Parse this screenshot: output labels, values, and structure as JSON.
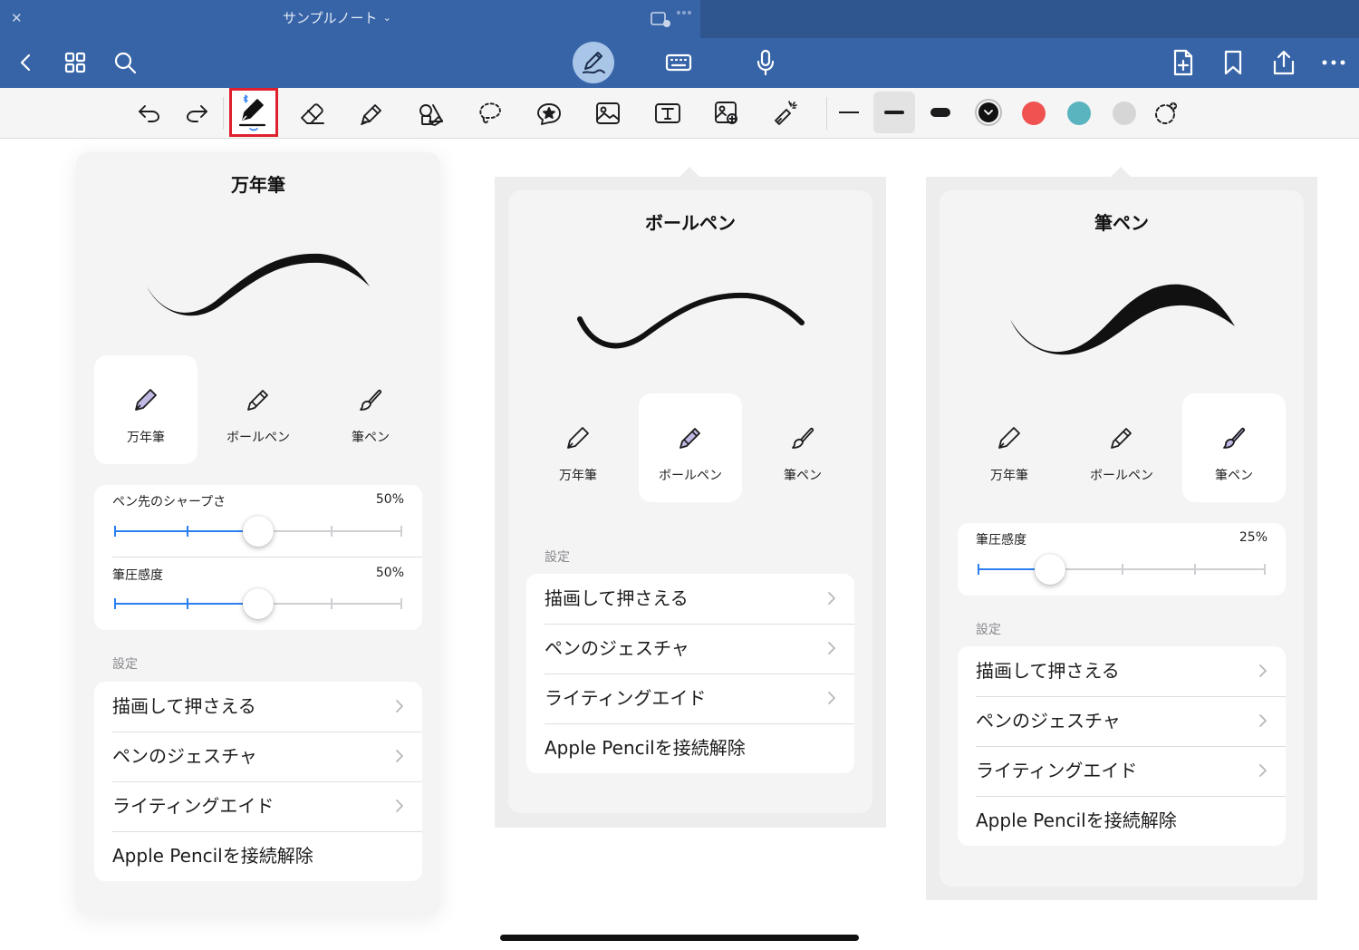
{
  "window": {
    "title": "サンプルノート",
    "close_icon": "close-icon"
  },
  "navbar": {
    "left_icons": [
      "back-icon",
      "grid-icon",
      "search-icon"
    ],
    "center_icons": [
      "pen-mode-icon",
      "keyboard-icon",
      "microphone-icon"
    ],
    "right_icons": [
      "add-page-icon",
      "bookmark-icon",
      "share-icon",
      "more-icon"
    ]
  },
  "toolbar": {
    "tools": [
      "undo-icon",
      "redo-icon",
      "fountain-pen-icon",
      "eraser-icon",
      "highlighter-icon",
      "shapes-icon",
      "lasso-icon",
      "sticker-icon",
      "image-icon",
      "textbox-icon",
      "camera-icon",
      "laser-pointer-icon"
    ],
    "selected_tool": "fountain-pen-icon",
    "stroke_widths": [
      "thin",
      "medium",
      "thick"
    ],
    "selected_width": "medium",
    "colors": [
      "#111111",
      "#f05252",
      "#5ab4c0",
      "#d6d6d6"
    ],
    "selected_color": "#111111"
  },
  "panels": [
    {
      "title": "万年筆",
      "pens": [
        {
          "label": "万年筆"
        },
        {
          "label": "ボールペン"
        },
        {
          "label": "筆ペン"
        }
      ],
      "selected_pen": 0,
      "sliders": [
        {
          "label": "ペン先のシャープさ",
          "value_text": "50%",
          "value": 0.5
        },
        {
          "label": "筆圧感度",
          "value_text": "50%",
          "value": 0.5
        }
      ],
      "settings_label": "設定",
      "settings": [
        "描画して押さえる",
        "ペンのジェスチャ",
        "ライティングエイド",
        "Apple Pencilを接続解除"
      ]
    },
    {
      "title": "ボールペン",
      "pens": [
        {
          "label": "万年筆"
        },
        {
          "label": "ボールペン"
        },
        {
          "label": "筆ペン"
        }
      ],
      "selected_pen": 1,
      "sliders": [],
      "settings_label": "設定",
      "settings": [
        "描画して押さえる",
        "ペンのジェスチャ",
        "ライティングエイド",
        "Apple Pencilを接続解除"
      ]
    },
    {
      "title": "筆ペン",
      "pens": [
        {
          "label": "万年筆"
        },
        {
          "label": "ボールペン"
        },
        {
          "label": "筆ペン"
        }
      ],
      "selected_pen": 2,
      "sliders": [
        {
          "label": "筆圧感度",
          "value_text": "25%",
          "value": 0.25
        }
      ],
      "settings_label": "設定",
      "settings": [
        "描画して押さえる",
        "ペンのジェスチャ",
        "ライティングエイド",
        "Apple Pencilを接続解除"
      ]
    }
  ]
}
